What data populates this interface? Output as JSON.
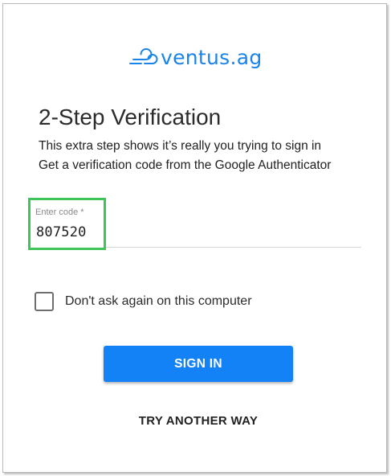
{
  "brand": {
    "name": "ventus.ag",
    "color": "#1a84e8"
  },
  "heading": {
    "title": "2-Step Verification",
    "line1": "This extra step shows it’s really you trying to sign in",
    "line2": "Get a verification code from the Google Authenticator"
  },
  "code_input": {
    "label": "Enter code *",
    "value": "807520",
    "highlight_color": "#3fc45a"
  },
  "remember": {
    "label": "Don't ask again on this computer",
    "checked": false
  },
  "actions": {
    "sign_in_label": "SIGN IN",
    "sign_in_color": "#1282f6",
    "try_another_label": "TRY ANOTHER WAY"
  }
}
